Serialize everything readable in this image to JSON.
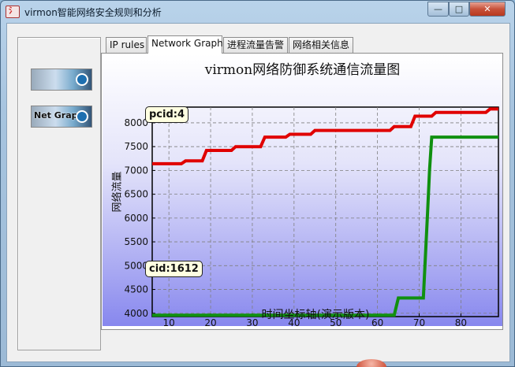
{
  "window": {
    "title": "virmon智能网络安全规则和分析",
    "controls": {
      "minimize": "—",
      "maximize": "□",
      "close": "✕"
    }
  },
  "sidebar": {
    "items": [
      {
        "label": "",
        "icon": "network-logo-icon"
      },
      {
        "label": "Net Graph",
        "icon": "graph-logo-icon"
      }
    ]
  },
  "tabs": [
    {
      "label": "IP rules",
      "active": false
    },
    {
      "label": "Network Graph",
      "active": true
    },
    {
      "label": "进程流量告警",
      "active": false
    },
    {
      "label": "网络相关信息",
      "active": false
    }
  ],
  "colors": {
    "series_red": "#e00000",
    "series_green": "#109010",
    "plot_grid": "#7f7f7f"
  },
  "chart_data": {
    "type": "line",
    "title": "virmon网络防御系统通信流量图",
    "xlabel": "时间坐标轴(演示版本)",
    "ylabel": "网络流量",
    "xlim": [
      6,
      89
    ],
    "ylim": [
      3930,
      8330
    ],
    "xticks": [
      10,
      20,
      30,
      40,
      50,
      60,
      70,
      80
    ],
    "yticks": [
      4000,
      4500,
      5000,
      5500,
      6000,
      6500,
      7000,
      7500,
      8000
    ],
    "grid": true,
    "annotations": [
      {
        "text": "pcid:4",
        "series": 0
      },
      {
        "text": "cid:1612",
        "series": 1
      }
    ],
    "series": [
      {
        "name": "",
        "color": "#e00000",
        "points": [
          [
            6,
            7140
          ],
          [
            13,
            7140
          ],
          [
            14,
            7200
          ],
          [
            18,
            7200
          ],
          [
            19,
            7420
          ],
          [
            25,
            7420
          ],
          [
            26,
            7500
          ],
          [
            32,
            7500
          ],
          [
            33,
            7700
          ],
          [
            38,
            7700
          ],
          [
            39,
            7760
          ],
          [
            44,
            7760
          ],
          [
            45,
            7840
          ],
          [
            63,
            7840
          ],
          [
            64,
            7920
          ],
          [
            68,
            7920
          ],
          [
            69,
            8140
          ],
          [
            73,
            8140
          ],
          [
            74,
            8220
          ],
          [
            86,
            8220
          ],
          [
            87,
            8290
          ],
          [
            89,
            8290
          ]
        ]
      },
      {
        "name": "",
        "color": "#109010",
        "points": [
          [
            6,
            3960
          ],
          [
            64,
            3960
          ],
          [
            65,
            4320
          ],
          [
            71,
            4320
          ],
          [
            72,
            6100
          ],
          [
            72.5,
            7020
          ],
          [
            73,
            7700
          ],
          [
            89,
            7700
          ]
        ]
      }
    ]
  }
}
